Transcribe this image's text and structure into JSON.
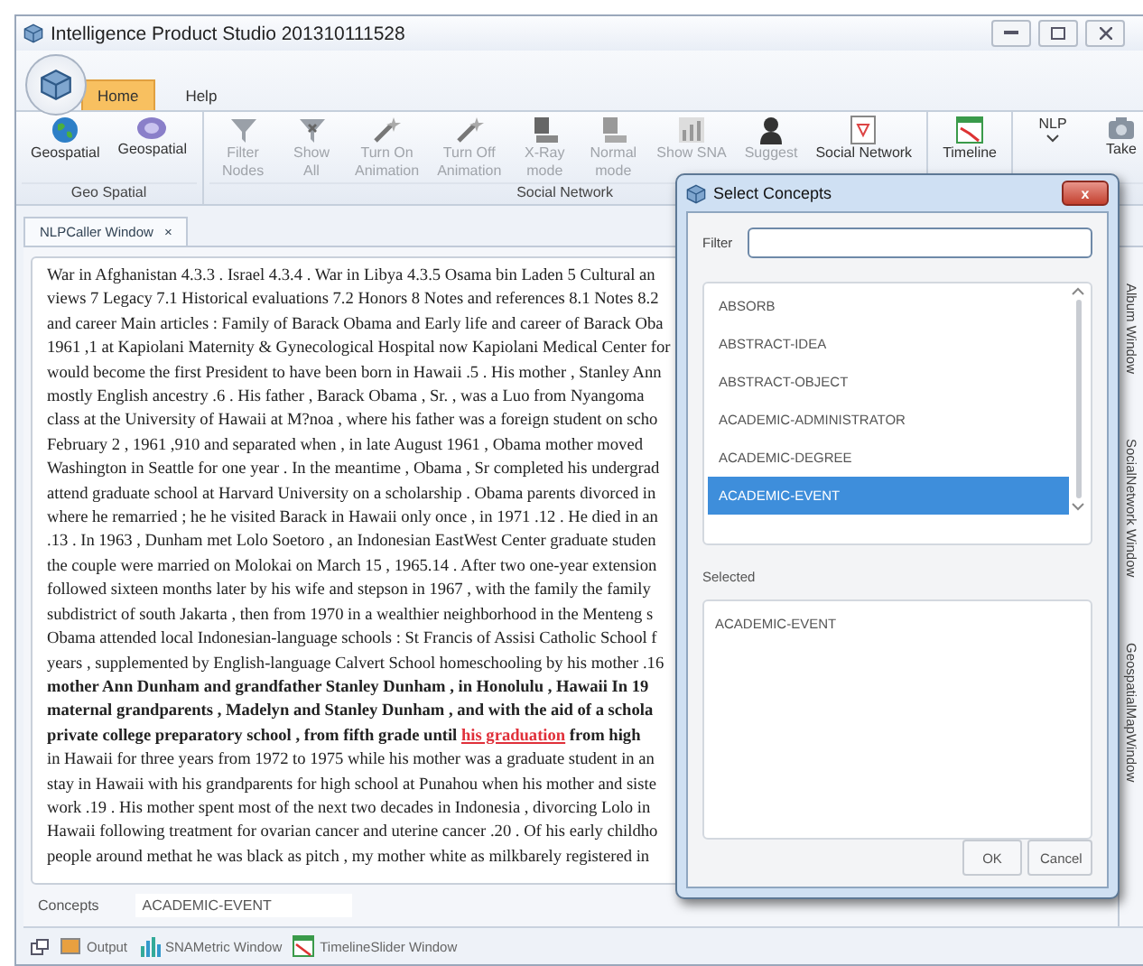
{
  "window": {
    "title": "Intelligence Product Studio 201310111528"
  },
  "ribbon_tabs": [
    {
      "label": "Home",
      "selected": true
    },
    {
      "label": "Help",
      "selected": false
    }
  ],
  "ribbon_groups": [
    {
      "label": "Geo Spatial",
      "buttons": [
        {
          "lines": [
            "Geospatial"
          ],
          "disabled": false
        },
        {
          "lines": [
            "Geospatial"
          ],
          "disabled": false
        }
      ]
    },
    {
      "label": "Social Network",
      "buttons": [
        {
          "lines": [
            "Filter",
            "Nodes"
          ],
          "disabled": true
        },
        {
          "lines": [
            "Show",
            "All"
          ],
          "disabled": true
        },
        {
          "lines": [
            "Turn On",
            "Animation"
          ],
          "disabled": true
        },
        {
          "lines": [
            "Turn Off",
            "Animation"
          ],
          "disabled": true
        },
        {
          "lines": [
            "X-Ray",
            "mode"
          ],
          "disabled": true
        },
        {
          "lines": [
            "Normal",
            "mode"
          ],
          "disabled": true
        },
        {
          "lines": [
            "Show SNA"
          ],
          "disabled": true
        },
        {
          "lines": [
            "Suggest"
          ],
          "disabled": true
        },
        {
          "lines": [
            "Social Network"
          ],
          "disabled": false
        }
      ]
    },
    {
      "buttons": [
        {
          "lines": [
            "Timeline"
          ],
          "disabled": false
        }
      ]
    },
    {
      "buttons": [
        {
          "lines": [
            "NLP"
          ],
          "disabled": false,
          "dropdown": true
        },
        {
          "lines": [
            "Take"
          ],
          "disabled": false
        }
      ]
    }
  ],
  "document_tab": {
    "label": "NLPCaller Window",
    "close": "×"
  },
  "text_lines": [
    {
      "text": "War in Afghanistan 4.3.3 . Israel 4.3.4 . War in Libya 4.3.5 Osama bin Laden 5 Cultural an",
      "bold": false
    },
    {
      "text": "views 7 Legacy 7.1 Historical evaluations 7.2 Honors 8 Notes and references 8.1 Notes 8.2",
      "bold": false
    },
    {
      "text": "and career Main articles : Family of Barack Obama and Early life and career of Barack Oba",
      "bold": false
    },
    {
      "text": "1961 ,1 at Kapiolani Maternity & Gynecological Hospital now Kapiolani Medical Center for",
      "bold": false
    },
    {
      "text": "would become the first President to have been born in Hawaii .5 . His mother , Stanley Ann",
      "bold": false
    },
    {
      "text": "mostly English ancestry .6 . His father , Barack Obama , Sr. , was a Luo from Nyangoma",
      "bold": false
    },
    {
      "text": "class at the University of Hawaii at M?noa , where his father was a foreign student on scho",
      "bold": false
    },
    {
      "text": "February 2 , 1961 ,910 and separated when , in late August 1961 , Obama mother moved",
      "bold": false
    },
    {
      "text": "Washington in Seattle for one year . In the meantime , Obama , Sr completed his undergrad",
      "bold": false
    },
    {
      "text": "attend graduate school at Harvard University on a scholarship . Obama parents divorced in",
      "bold": false
    },
    {
      "text": "where he remarried ; he he visited Barack in Hawaii only once , in 1971 .12 . He died in an",
      "bold": false
    },
    {
      "text": ".13 . In 1963 , Dunham met Lolo Soetoro , an Indonesian EastWest Center graduate studen",
      "bold": false
    },
    {
      "text": "the couple were married on Molokai on March 15 , 1965.14 . After two one-year extension",
      "bold": false
    },
    {
      "text": "followed sixteen months later by his wife and stepson in 1967 , with the family the family",
      "bold": false
    },
    {
      "text": "subdistrict of south Jakarta , then from 1970 in a wealthier neighborhood in the Menteng s",
      "bold": false
    },
    {
      "text": "Obama attended local Indonesian-language schools : St Francis of Assisi Catholic School f",
      "bold": false
    },
    {
      "text": "years , supplemented by English-language Calvert School homeschooling by his mother .16",
      "bold": false
    },
    {
      "text": "mother Ann Dunham and grandfather Stanley Dunham , in Honolulu , Hawaii In 19",
      "bold": true
    },
    {
      "text": "maternal grandparents , Madelyn and Stanley Dunham , and with the aid of a schola",
      "bold": true
    },
    {
      "text": "private college preparatory school , from fifth grade until ",
      "bold": true,
      "link": "his graduation",
      "after": " from high"
    },
    {
      "text": "in Hawaii for three years from 1972 to 1975 while his mother was a graduate student in an",
      "bold": false
    },
    {
      "text": "stay in Hawaii with his grandparents for high school at Punahou when his mother and siste",
      "bold": false
    },
    {
      "text": "work .19 . His mother spent most of the next two decades in Indonesia , divorcing Lolo in",
      "bold": false
    },
    {
      "text": "Hawaii following treatment for ovarian cancer and uterine cancer .20 . Of his early childho",
      "bold": false
    },
    {
      "text": "people around methat he was black as pitch , my mother white as milkbarely registered in",
      "bold": false
    }
  ],
  "side_tabs": [
    "Album Window",
    "SocialNetwork Window",
    "GeospatialMapWindow"
  ],
  "concepts": {
    "label": "Concepts",
    "value": "ACADEMIC-EVENT"
  },
  "bottom_tabs": [
    "Output",
    "SNAMetric Window",
    "TimelineSlider Window"
  ],
  "dialog": {
    "title": "Select Concepts",
    "close": "x",
    "filter_label": "Filter",
    "items": [
      {
        "label": "ABSORB",
        "selected": false
      },
      {
        "label": "ABSTRACT-IDEA",
        "selected": false
      },
      {
        "label": "ABSTRACT-OBJECT",
        "selected": false
      },
      {
        "label": "ACADEMIC-ADMINISTRATOR",
        "selected": false
      },
      {
        "label": "ACADEMIC-DEGREE",
        "selected": false
      },
      {
        "label": "ACADEMIC-EVENT",
        "selected": true
      }
    ],
    "selected_label": "Selected",
    "selected_items": [
      "ACADEMIC-EVENT"
    ],
    "buttons": [
      "OK",
      "Cancel"
    ]
  }
}
